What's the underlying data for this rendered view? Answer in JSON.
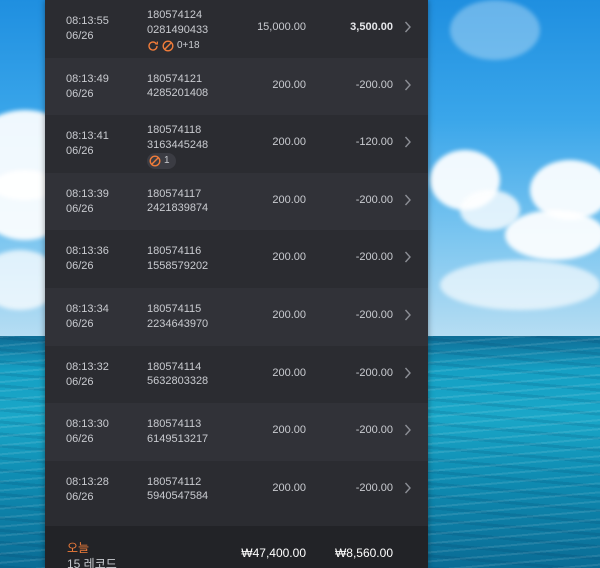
{
  "theme": {
    "accent": "#f07c3a",
    "panel_bg": "#2b2c31",
    "row_alt_bg": "#313238",
    "text": "#c9cbd0"
  },
  "rows": [
    {
      "time": "08:13:55",
      "date": "06/26",
      "id1": "180574124",
      "id2": "0281490433",
      "bet": "15,000.00",
      "win": "3,500.00",
      "badge_text": "0+18"
    },
    {
      "time": "08:13:49",
      "date": "06/26",
      "id1": "180574121",
      "id2": "4285201408",
      "bet": "200.00",
      "win": "-200.00"
    },
    {
      "time": "08:13:41",
      "date": "06/26",
      "id1": "180574118",
      "id2": "3163445248",
      "bet": "200.00",
      "win": "-120.00",
      "badge_text": "1"
    },
    {
      "time": "08:13:39",
      "date": "06/26",
      "id1": "180574117",
      "id2": "2421839874",
      "bet": "200.00",
      "win": "-200.00"
    },
    {
      "time": "08:13:36",
      "date": "06/26",
      "id1": "180574116",
      "id2": "1558579202",
      "bet": "200.00",
      "win": "-200.00"
    },
    {
      "time": "08:13:34",
      "date": "06/26",
      "id1": "180574115",
      "id2": "2234643970",
      "bet": "200.00",
      "win": "-200.00"
    },
    {
      "time": "08:13:32",
      "date": "06/26",
      "id1": "180574114",
      "id2": "5632803328",
      "bet": "200.00",
      "win": "-200.00"
    },
    {
      "time": "08:13:30",
      "date": "06/26",
      "id1": "180574113",
      "id2": "6149513217",
      "bet": "200.00",
      "win": "-200.00"
    },
    {
      "time": "08:13:28",
      "date": "06/26",
      "id1": "180574112",
      "id2": "5940547584",
      "bet": "200.00",
      "win": "-200.00"
    }
  ],
  "footer": {
    "today_label": "오늘",
    "records_label": "15 레코드",
    "total_bet": "₩47,400.00",
    "total_win": "₩8,560.00"
  },
  "icons": {
    "row_chevron": "chevron-right-icon",
    "free_spin": "refresh-icon",
    "bonus": "no-sign-icon"
  }
}
